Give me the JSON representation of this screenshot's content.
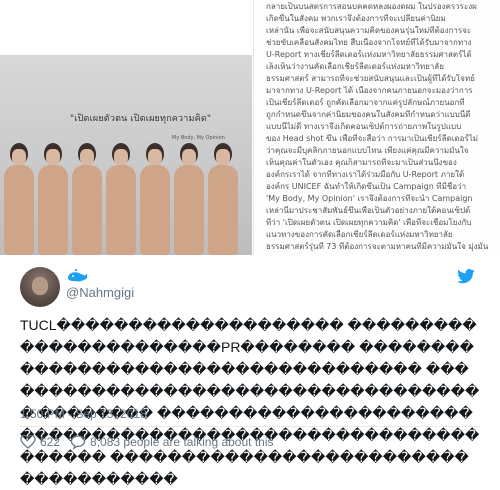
{
  "media": {
    "caption": "\"เปิดเผยตัวตน เปิดเผยทุกความคิด\"",
    "caption_sub": "My Body, My Opinion",
    "doc_lines": [
      "กลายเป็นบนสตรการสอนบคคดหลงผองดผม ในปรองครวระงผ",
      "เกิดขึ้นในสังคม พวกเราจึงต้องการที่จะเปลี่ยนค่านิยม",
      "เหล่านั้น เพื่อจะสนับสนุนความคิดของคนรุ่นใหม่ที่ต้องการจะ",
      "ช่วยขับเคลื่อนสังคมไทย  สืบเนื่องจากโจทย์ที่ได้รับมาจากทาง",
      "U-Report ทางเชียร์ลีดเดอร์แห่งมหาวิทยาลัยธรรมศาสตร์ได้",
      "เล็งเห็นว่างานคัดเลือกเชียร์ลีดเดอร์แห่งมหาวิทยาลัย",
      "ธรรมศาสตร์ สามารถที่จะช่วยสนับสนุนและเป็นผู้ที่ได้รับโจทย์",
      "มาจากทาง U-Report ได้ เนื่องจากคนภายนอกจะมองว่าการ",
      "เป็นเชียร์ลีดเดอร์ ถูกคัดเลือกมาจากแค่รูปลักษณ์ภายนอกที่",
      "ถูกกำหนดขึ้นจากค่านิยมของคนในสังคมที่กำหนดว่าแบบนี้ดี",
      "แบบนี้ไม่ดี ทางเราจึงเกิดคอนเซ็ปต์การถ่ายภาพในรูปแบบ",
      "ของ Head shot ขึ้น เพื่อที่จะสื่อว่า การมาเป็นเชียร์ลีดเดอร์ไม่",
      "ว่าคุณจะมีบุคลิกภายนอกแบบไหน เพียงแค่คุณมีความมั่นใจ",
      "เห็นคุณค่าในตัวเอง คุณก็สามารถที่จะมาเป็นส่วนนึงของ",
      "องค์กรเราได้  จากที่ทางเราได้ร่วมมือกับ U-Report ภายใต้",
      "องค์กร UNICEF ฉันทำให้เกิดขึ้นเป็น Campaign ที่มีชื่อว่า",
      "'My Body, My Opinion' เราจึงต้องการที่จะนำ Campaign",
      "เหล่านี้มาประชาสัมพันธ์ขึ้นเพื่อเป็นตัวอย่างภายใต้คอนเซ็ปต์",
      "ที่ว่า 'เปิดเผยตัวตน เปิดเผยทุกความคิด' เพื่อที่จะเชื่อมโยงกับ",
      "แนวทางของการคัดเลือกเชียร์ลีดเดอร์แห่งมหาวิทยาลัย",
      "ธรรมศาสตร์รุ่นที่ 73 ที่ต้องการจะตามหาคนที่มีความมั่นใจ มุ่งมั่น"
    ]
  },
  "author": {
    "handle": "@Nahmgigi"
  },
  "tweet": {
    "text": "TUCL�������������������� �����������������������PR�������� ������������������������������������ ������������������������������������ �������� ������������������������������������������������������������ ������������������������������������",
    "timestamp": "1:50 PM - Sep 13, 2018"
  },
  "footer": {
    "likes": "622",
    "talking": "8,083 people are talking about this"
  },
  "colors": {
    "twitter_blue": "#1da1f2",
    "muted": "#657786"
  }
}
